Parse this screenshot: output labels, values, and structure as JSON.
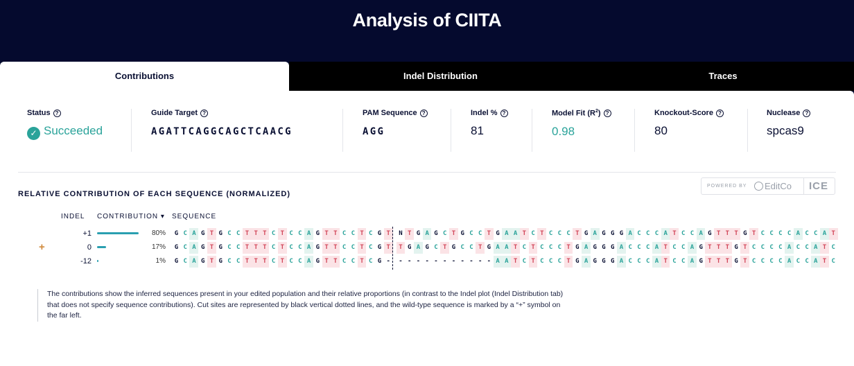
{
  "header": {
    "title": "Analysis of CIITA"
  },
  "tabs": [
    {
      "label": "Contributions",
      "active": true
    },
    {
      "label": "Indel Distribution",
      "active": false
    },
    {
      "label": "Traces",
      "active": false
    }
  ],
  "stats": {
    "status": {
      "label": "Status",
      "value": "Succeeded"
    },
    "guide_target": {
      "label": "Guide Target",
      "value": "AGATTCAGGCAGCTCAACG"
    },
    "pam_sequence": {
      "label": "PAM Sequence",
      "value": "AGG"
    },
    "indel_pct": {
      "label": "Indel %",
      "value": "81"
    },
    "model_fit": {
      "label_prefix": "Model Fit (R",
      "label_sup": "2",
      "label_suffix": ")",
      "value": "0.98"
    },
    "knockout_score": {
      "label": "Knockout-Score",
      "value": "80"
    },
    "nuclease": {
      "label": "Nuclease",
      "value": "spcas9"
    }
  },
  "branding": {
    "powered_by": "POWERED BY",
    "company": "EditCo",
    "product": "ICE"
  },
  "section_title": "RELATIVE CONTRIBUTION OF EACH SEQUENCE (NORMALIZED)",
  "columns": {
    "indel": "INDEL",
    "contribution": "CONTRIBUTION",
    "contribution_sort": "▾",
    "sequence": "SEQUENCE"
  },
  "wild_type_marker": "+",
  "rows": [
    {
      "indel": "+1",
      "contribution_pct": "80%",
      "contribution": 0.8,
      "wild_type": false,
      "left": "GCAGTGCCTTTCTCCAGTTCCTCGT",
      "right": "NTGAGCTGCCTGAATCTCCCTGAGGGACCCATCCAGTTTGTCCCCACCAT"
    },
    {
      "indel": "0",
      "contribution_pct": "17%",
      "contribution": 0.17,
      "wild_type": true,
      "left": "GCAGTGCCTTTCTCCAGTTCCTCGT",
      "right": "TGAGCTGCCTGAATCTCCCTGAGGGACCCATCCAGTTTGTCCCCACCATC"
    },
    {
      "indel": "-12",
      "contribution_pct": "1%",
      "contribution": 0.01,
      "wild_type": false,
      "left": "GCAGTGCCTTTCTCCAGTTCCTCG-",
      "right": "-----------AATCTCCCTGAGGGACCCATCCAGTTTGTCCCCACCATC"
    }
  ],
  "base_colors": {
    "A": {
      "bg": "#e3f3ef",
      "fg": "#2aa39a"
    },
    "C": {
      "bg": "#ffffff",
      "fg": "#2aa39a"
    },
    "G": {
      "bg": "#ffffff",
      "fg": "#0a1033"
    },
    "T": {
      "bg": "#fbe3e6",
      "fg": "#d2475a"
    },
    "N": {
      "bg": "#ffffff",
      "fg": "#0a1033"
    },
    "-": {
      "bg": "#ffffff",
      "fg": "#0a1033"
    }
  },
  "description": "The contributions show the inferred sequences present in your edited population and their relative proportions (in contrast to the Indel plot (Indel Distribution tab) that does not specify sequence contributions). Cut sites are represented by black vertical dotted lines, and the wild-type sequence is marked by a “+” symbol on the far left."
}
